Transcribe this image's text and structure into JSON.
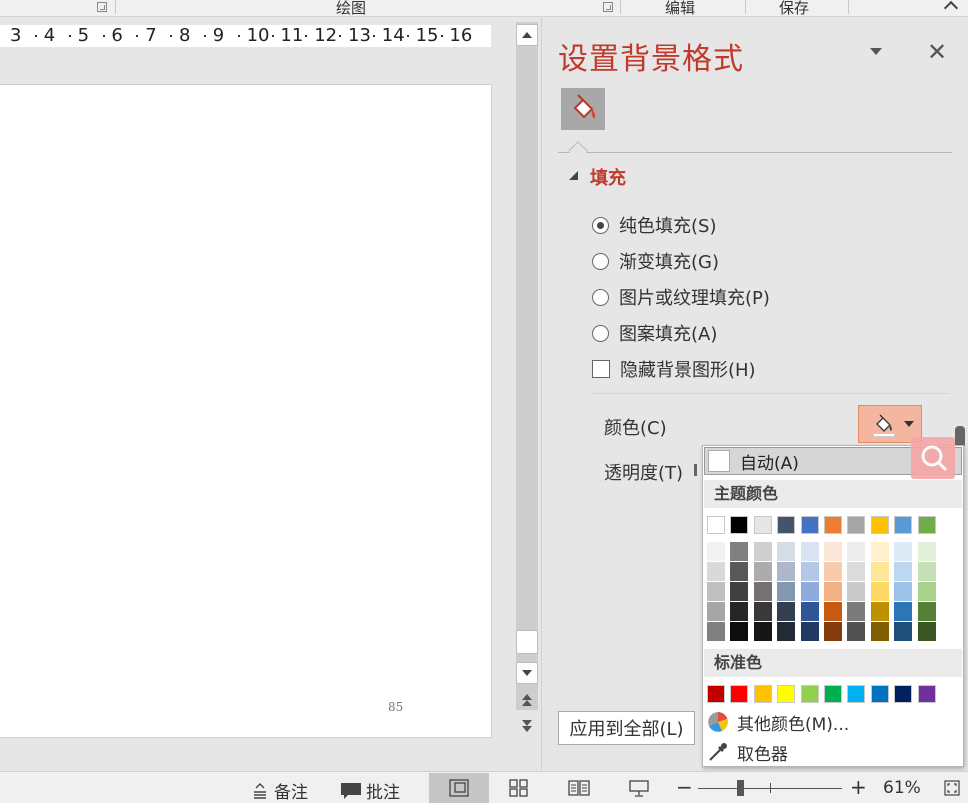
{
  "ribbon": {
    "group_drawing": "绘图",
    "group_edit": "编辑",
    "group_save": "保存"
  },
  "ruler": {
    "ticks": [
      "3",
      "4",
      "5",
      "6",
      "7",
      "8",
      "9",
      "10",
      "11",
      "12",
      "13",
      "14",
      "15",
      "16"
    ]
  },
  "slide": {
    "page_number": "85"
  },
  "pane": {
    "title": "设置背景格式",
    "fill_section": "填充",
    "options": {
      "solid": "纯色填充(S)",
      "gradient": "渐变填充(G)",
      "picture": "图片或纹理填充(P)",
      "pattern": "图案填充(A)",
      "hide_graphics": "隐藏背景图形(H)"
    },
    "selected_option": "solid",
    "color_label": "颜色(C)",
    "transparency_label": "透明度(T)",
    "apply_all": "应用到全部(L)"
  },
  "color_menu": {
    "auto": "自动(A)",
    "theme_header": "主题颜色",
    "standard_header": "标准色",
    "more_colors": "其他颜色(M)...",
    "eyedropper": "取色器",
    "theme_colors": [
      "#ffffff",
      "#000000",
      "#e7e6e6",
      "#44546a",
      "#4472c4",
      "#ed7d31",
      "#a5a5a5",
      "#ffc000",
      "#5b9bd5",
      "#70ad47"
    ],
    "theme_shades": [
      [
        "#f2f2f2",
        "#d9d9d9",
        "#bfbfbf",
        "#a6a6a6",
        "#808080"
      ],
      [
        "#808080",
        "#595959",
        "#404040",
        "#262626",
        "#0d0d0d"
      ],
      [
        "#d0cece",
        "#aeabab",
        "#757171",
        "#3a3838",
        "#171616"
      ],
      [
        "#d6dce4",
        "#adb9ca",
        "#8497b0",
        "#333f4f",
        "#222a35"
      ],
      [
        "#dae3f3",
        "#b4c7e7",
        "#8faadc",
        "#2f5597",
        "#1f3864"
      ],
      [
        "#fbe5d6",
        "#f8cbad",
        "#f4b183",
        "#c55a11",
        "#843c0c"
      ],
      [
        "#ededed",
        "#dbdbdb",
        "#c9c9c9",
        "#7b7b7b",
        "#525252"
      ],
      [
        "#fff2cc",
        "#ffe699",
        "#ffd966",
        "#bf9000",
        "#7f6000"
      ],
      [
        "#deebf7",
        "#bdd7ee",
        "#9dc3e6",
        "#2e75b6",
        "#1f4e79"
      ],
      [
        "#e2f0d9",
        "#c5e0b4",
        "#a9d18e",
        "#548235",
        "#385723"
      ]
    ],
    "standard_colors": [
      "#c00000",
      "#ff0000",
      "#ffc000",
      "#ffff00",
      "#92d050",
      "#00b050",
      "#00b0f0",
      "#0070c0",
      "#002060",
      "#7030a0"
    ]
  },
  "status": {
    "notes": "备注",
    "comments": "批注",
    "zoom_minus": "−",
    "zoom_plus": "+",
    "zoom_value": "61%"
  },
  "colors": {
    "accent": "#c0392b",
    "color_button_bg": "#f4b6a0"
  }
}
